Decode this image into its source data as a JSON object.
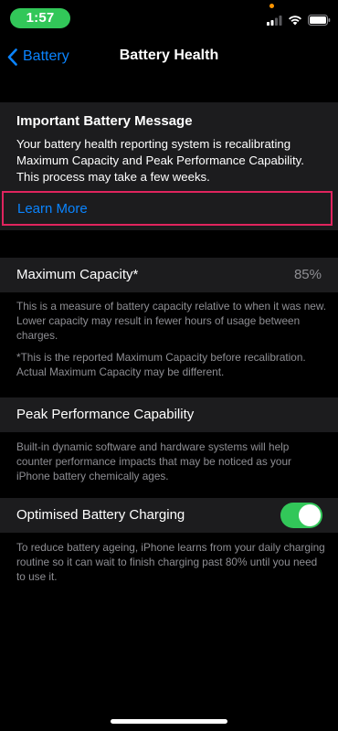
{
  "status_bar": {
    "time": "1:57",
    "time_color": "#32c759"
  },
  "nav": {
    "back_label": "Battery",
    "title": "Battery Health",
    "accent_color": "#0a84ff"
  },
  "message": {
    "title": "Important Battery Message",
    "body": "Your battery health reporting system is recalibrating Maximum Capacity and Peak Performance Capability. This process may take a few weeks.",
    "link_label": "Learn More",
    "highlight_color": "#e0245e"
  },
  "maximum_capacity": {
    "label": "Maximum Capacity*",
    "value": "85%",
    "description": "This is a measure of battery capacity relative to when it was new. Lower capacity may result in fewer hours of usage between charges.",
    "note": "*This is the reported Maximum Capacity before recalibration. Actual Maximum Capacity may be different."
  },
  "peak_performance": {
    "label": "Peak Performance Capability",
    "description": "Built-in dynamic software and hardware systems will help counter performance impacts that may be noticed as your iPhone battery chemically ages."
  },
  "optimised_charging": {
    "label": "Optimised Battery Charging",
    "enabled": true,
    "toggle_color": "#32c759",
    "description": "To reduce battery ageing, iPhone learns from your daily charging routine so it can wait to finish charging past 80% until you need to use it."
  },
  "icons": {
    "signal": "cellular-signal-icon",
    "wifi": "wifi-icon",
    "battery": "battery-icon",
    "back": "chevron-left-icon"
  }
}
